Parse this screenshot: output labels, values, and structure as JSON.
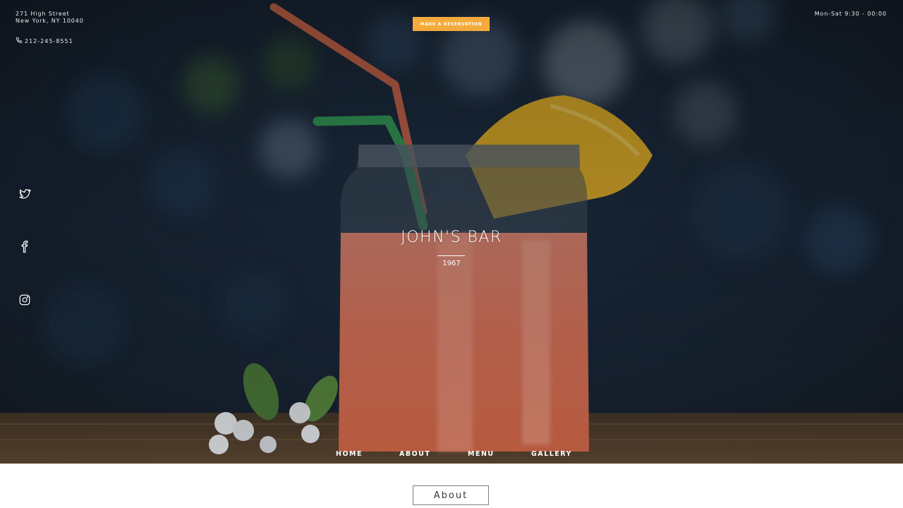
{
  "header": {
    "address_line1": "271 High Street",
    "address_line2": "New York, NY 10040",
    "phone": "212-245-8551",
    "hours": "Mon-Sat 9:30 - 00:00",
    "reservation_label": "MAKE A RESERVATION"
  },
  "social": [
    {
      "name": "twitter-icon"
    },
    {
      "name": "facebook-icon"
    },
    {
      "name": "instagram-icon"
    }
  ],
  "hero": {
    "title": "JOHN'S BAR",
    "year": "1967"
  },
  "nav": {
    "items": [
      {
        "label": "HOME"
      },
      {
        "label": "ABOUT"
      },
      {
        "label": "MENU"
      },
      {
        "label": "GALLERY"
      }
    ]
  },
  "section": {
    "about_label": "About"
  },
  "colors": {
    "accent": "#f5ab3c",
    "overlay": "#1b2531",
    "text_light": "#ffffff"
  }
}
